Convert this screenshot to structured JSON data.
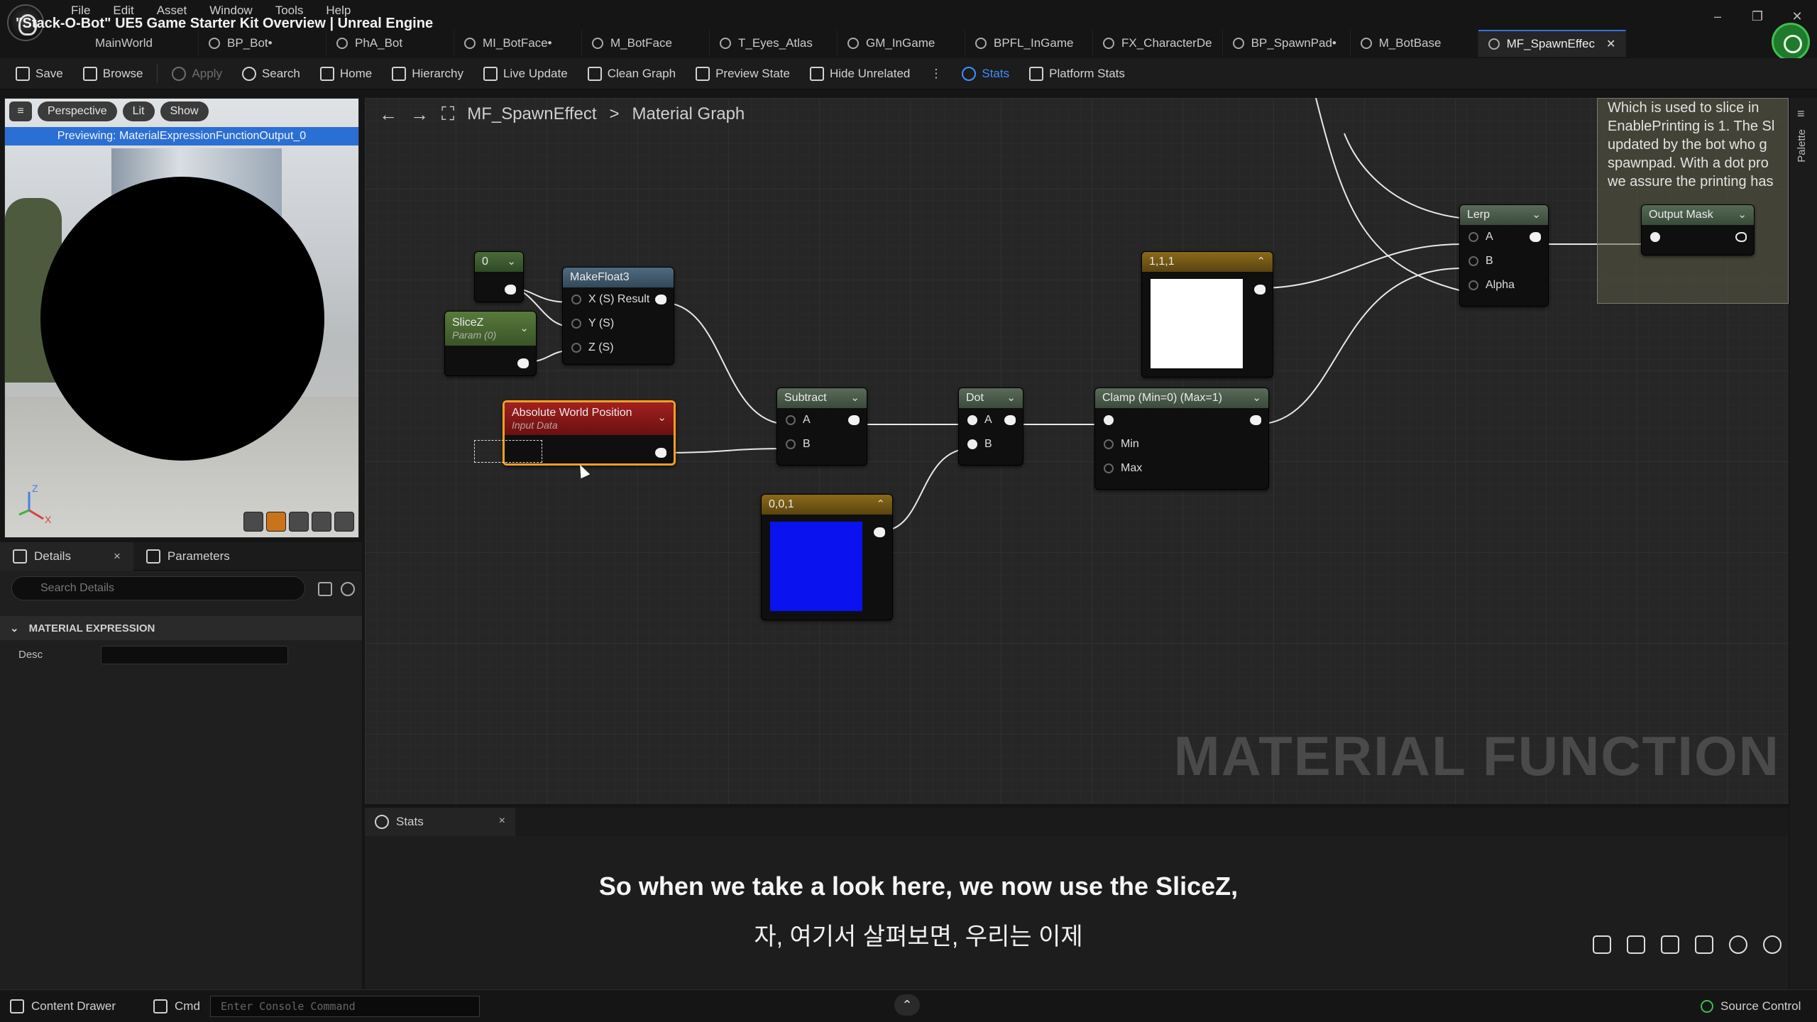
{
  "window": {
    "title": "\"Stack-O-Bot\" UE5 Game Starter Kit Overview | Unreal Engine",
    "menu": [
      "File",
      "Edit",
      "Asset",
      "Window",
      "Tools",
      "Help"
    ],
    "controls": [
      "–",
      "❐",
      "✕"
    ]
  },
  "tabs": [
    {
      "label": "MainWorld"
    },
    {
      "label": "BP_Bot•"
    },
    {
      "label": "PhA_Bot"
    },
    {
      "label": "MI_BotFace•"
    },
    {
      "label": "M_BotFace"
    },
    {
      "label": "T_Eyes_Atlas"
    },
    {
      "label": "GM_InGame"
    },
    {
      "label": "BPFL_InGame"
    },
    {
      "label": "FX_CharacterDe"
    },
    {
      "label": "BP_SpawnPad•"
    },
    {
      "label": "M_BotBase"
    },
    {
      "label": "MF_SpawnEffec",
      "close": "✕"
    }
  ],
  "toolbar": {
    "save": "Save",
    "browse": "Browse",
    "apply": "Apply",
    "search": "Search",
    "home": "Home",
    "hierarchy": "Hierarchy",
    "live_update": "Live Update",
    "clean_graph": "Clean Graph",
    "preview_state": "Preview State",
    "hide_unrelated": "Hide Unrelated",
    "more": "⋮",
    "stats": "Stats",
    "platform_stats": "Platform Stats"
  },
  "viewport": {
    "menu_glyph": "≡",
    "perspective": "Perspective",
    "lit": "Lit",
    "show": "Show",
    "previewing": "Previewing: MaterialExpressionFunctionOutput_0",
    "axis_z": "Z",
    "axis_x": "X"
  },
  "details": {
    "tab_details": "Details",
    "tab_close": "×",
    "tab_parameters": "Parameters",
    "search_placeholder": "Search Details",
    "category": "MATERIAL EXPRESSION",
    "desc_label": "Desc",
    "desc_value": ""
  },
  "graph": {
    "breadcrumb_asset": "MF_SpawnEffect",
    "breadcrumb_sep": ">",
    "breadcrumb_graph": "Material Graph",
    "watermark": "MATERIAL FUNCTION",
    "comment": "Which is used to slice in EnablePrinting is 1. The Sl updated by the bot who g spawnpad. With a dot pro we assure the printing has",
    "nodes": {
      "const0": {
        "title": "0"
      },
      "slicez": {
        "title": "SliceZ",
        "subtitle": "Param (0)"
      },
      "makefloat3": {
        "title": "MakeFloat3",
        "pins": [
          "X (S)",
          "Y (S)",
          "Z (S)"
        ],
        "output": "Result"
      },
      "awp": {
        "title": "Absolute World Position",
        "subtitle": "Input Data"
      },
      "subtract": {
        "title": "Subtract",
        "pins": [
          "A",
          "B"
        ]
      },
      "dot": {
        "title": "Dot",
        "pins": [
          "A",
          "B"
        ]
      },
      "clamp": {
        "title": "Clamp (Min=0) (Max=1)",
        "pins": [
          "Min",
          "Max"
        ]
      },
      "const001": {
        "title": "0,0,1",
        "color": "#0a12f0"
      },
      "const111": {
        "title": "1,1,1",
        "color": "#ffffff"
      },
      "lerp": {
        "title": "Lerp",
        "pins": [
          "A",
          "B",
          "Alpha"
        ]
      },
      "output_mask": {
        "title": "Output Mask"
      }
    }
  },
  "stats_panel": {
    "tab": "Stats",
    "close": "×"
  },
  "subtitles": {
    "english": "So when we take a look here, we now use the SliceZ,",
    "korean": "자, 여기서 살펴보면, 우리는 이제"
  },
  "bottom": {
    "content_drawer": "Content Drawer",
    "cmd": "Cmd",
    "console_placeholder": "Enter Console Command",
    "source_control": "Source Control"
  },
  "palette_label": "Palette",
  "colors": {
    "accent": "#2a6fd4",
    "selection": "#f0a020",
    "vector3_header": "#8a6a1a",
    "function_header": "#556b55"
  }
}
